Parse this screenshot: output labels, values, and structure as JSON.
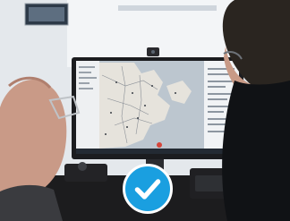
{
  "image": {
    "kind": "photo",
    "scene": "two-people-viewing-map-on-monitor",
    "overlay_icon": "checkmark-icon",
    "colors": {
      "wall": "#e9ecef",
      "monitor_screen": "#d9dde2",
      "map_water": "#bcc6cf",
      "badge": "#1a9fe0",
      "desk": "#1c1c1e"
    }
  }
}
